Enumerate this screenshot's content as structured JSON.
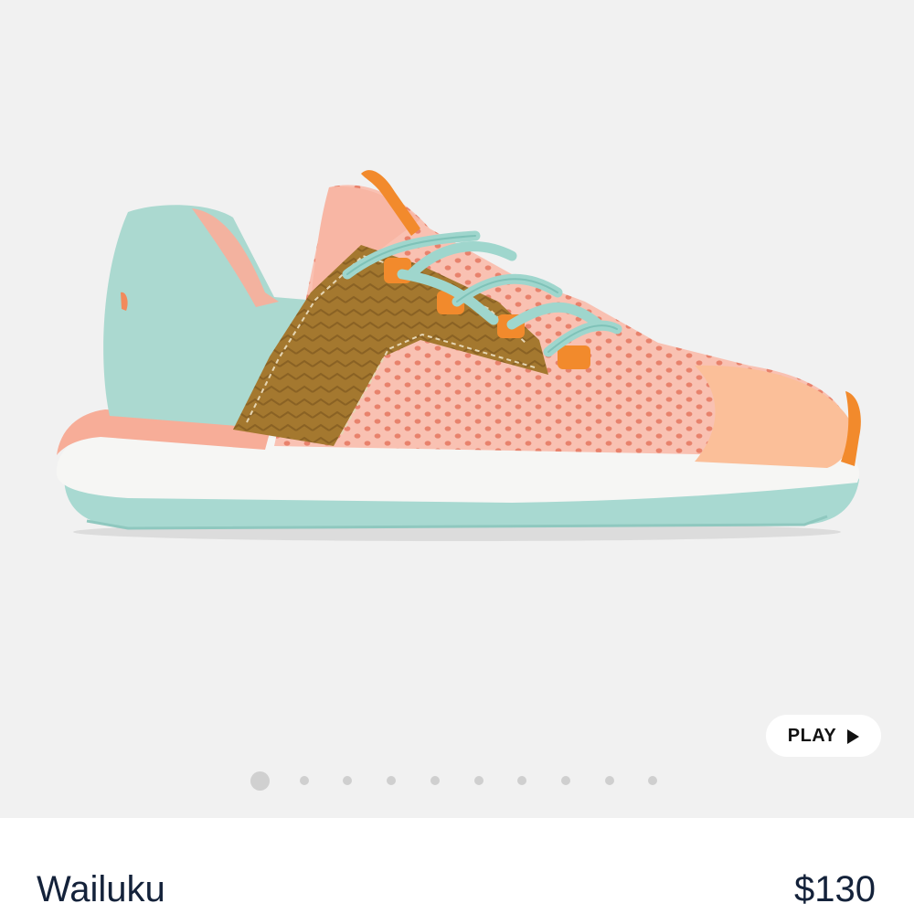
{
  "gallery": {
    "background_color": "#f1f1f1",
    "image_alt": "Wailuku sneaker side view in peach mesh with mint heel and brown saddle",
    "play_label": "PLAY",
    "play_icon": "play-triangle-icon",
    "page_count": 10,
    "active_page": 1
  },
  "product": {
    "name": "Wailuku",
    "price": "$130"
  },
  "colors": {
    "text": "#14223a",
    "shoe_mesh": "#f7b3a3",
    "shoe_heel": "#a8d8d0",
    "shoe_saddle": "#a87a32",
    "shoe_accent": "#f28a2c"
  }
}
